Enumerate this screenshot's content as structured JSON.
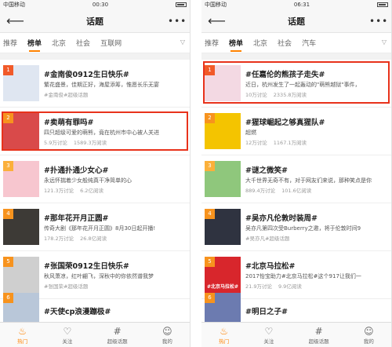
{
  "status": {
    "left": {
      "carrier": "中国移动",
      "time": "00:30"
    },
    "right": {
      "carrier": "中国移动",
      "time": "06:31"
    }
  },
  "nav": {
    "title": "话题",
    "back_icon": "arrow-left-icon",
    "more_icon": "more-dots-icon"
  },
  "left_tabs": [
    "推荐",
    "榜单",
    "北京",
    "社会",
    "互联网"
  ],
  "right_tabs": [
    "推荐",
    "榜单",
    "北京",
    "社会",
    "汽车"
  ],
  "active_tab": "榜单",
  "accent_color": "#ff8200",
  "highlight_color": "#e8321b",
  "left_items": [
    {
      "rank": "1",
      "topic": "#金南俊0912生日快乐#",
      "desc": "繁花盛景，佳期正好，海屋添筹，惟愿长乐无宴",
      "stats": [
        "#金南俊#超级话题"
      ],
      "rank_color": "#f15a29",
      "thumb_color": "#dfe6f1",
      "thumb_icon": "person-photo"
    },
    {
      "rank": "2",
      "topic": "#卖萌有罪吗#",
      "desc": "四只超级可爱的萌熊，竟在杭州市中心被人关进",
      "stats": [
        "5.9万讨论",
        "1589.3万阅读"
      ],
      "rank_color": "#f7931e",
      "thumb_color": "#d94a4a",
      "thumb_icon": "bear-photo"
    },
    {
      "rank": "3",
      "topic": "#扑通扑通少女心#",
      "desc": "永远怀揣着少女般纯真干净简单的心",
      "stats": [
        "121.3万讨论",
        "6.2亿阅读"
      ],
      "rank_color": "#fbb03b",
      "thumb_color": "#f7c6cf",
      "thumb_icon": "heart-photo"
    },
    {
      "rank": "4",
      "topic": "#那年花开月正圆#",
      "desc": "传奇大剧《那年花开月正圆》8月30日起开播!",
      "stats": [
        "178.2万讨论",
        "26.8亿阅读"
      ],
      "rank_color": "#f7931e",
      "thumb_color": "#3d3a36",
      "thumb_icon": "drama-poster"
    },
    {
      "rank": "5",
      "topic": "#张国荣0912生日快乐#",
      "desc": "秋风萧凉，红叶翩飞，深秋中的你依然谱我梦",
      "stats": [
        "#张国荣#超级话题"
      ],
      "rank_color": "#f7931e",
      "thumb_color": "#cfcfcf",
      "thumb_icon": "person-photo"
    },
    {
      "rank": "6",
      "topic": "#天使cp浪漫蹦极#",
      "desc": "",
      "stats": [],
      "rank_color": "#f7931e",
      "thumb_color": "#b9c7d9",
      "thumb_icon": "photo"
    }
  ],
  "right_items": [
    {
      "rank": "1",
      "topic": "#任嘉伦的熊孩子走失#",
      "desc": "近日，杭州发生了一起轰动的\"萌熊越狱\"事件，",
      "stats": [
        "10万讨论",
        "2335.8万阅读"
      ],
      "rank_color": "#f15a29",
      "thumb_color": "#f3d9e3",
      "thumb_icon": "person-photo"
    },
    {
      "rank": "2",
      "topic": "#猩球崛起之够真猩队#",
      "desc": "超燃",
      "stats": [
        "12万讨论",
        "1167.1万阅读"
      ],
      "rank_color": "#f7931e",
      "thumb_color": "#f4c400",
      "thumb_icon": "monkey-photo"
    },
    {
      "rank": "3",
      "topic": "#谜之微笑#",
      "desc": "大千世界无奇不有，对于网友们来说，那种笑点是你",
      "stats": [
        "889.4万讨论",
        "101.6亿阅读"
      ],
      "rank_color": "#fbb03b",
      "thumb_color": "#8fc77c",
      "thumb_icon": "frog-photo"
    },
    {
      "rank": "4",
      "topic": "#吴亦凡伦敦时装周#",
      "desc": "吴亦凡第四次受Burberry之邀，将于伦敦时间9",
      "stats": [
        "#吴亦凡#超级话题"
      ],
      "rank_color": "#f7931e",
      "thumb_color": "#2f3340",
      "thumb_icon": "person-photo"
    },
    {
      "rank": "5",
      "topic": "#北京马拉松#",
      "desc": "2017怡宝助力#北京马拉松#这个917让我们一",
      "stats": [
        "21.9万讨论",
        "9.9亿阅读"
      ],
      "rank_color": "#f7931e",
      "thumb_color": "#d8262c",
      "thumb_icon": "marathon-poster",
      "thumb_text": "#北京马拉松#"
    },
    {
      "rank": "6",
      "topic": "#明日之子#",
      "desc": "",
      "stats": [],
      "rank_color": "#f7931e",
      "thumb_color": "#6c7bb0",
      "thumb_icon": "photo"
    }
  ],
  "bottom_tabs": [
    {
      "label": "热门",
      "icon": "flame-icon",
      "glyph": "♨"
    },
    {
      "label": "关注",
      "icon": "heart-icon",
      "glyph": "♡"
    },
    {
      "label": "超级话题",
      "icon": "hashtag-icon",
      "glyph": "#"
    },
    {
      "label": "我的",
      "icon": "user-icon",
      "glyph": "☺"
    }
  ]
}
